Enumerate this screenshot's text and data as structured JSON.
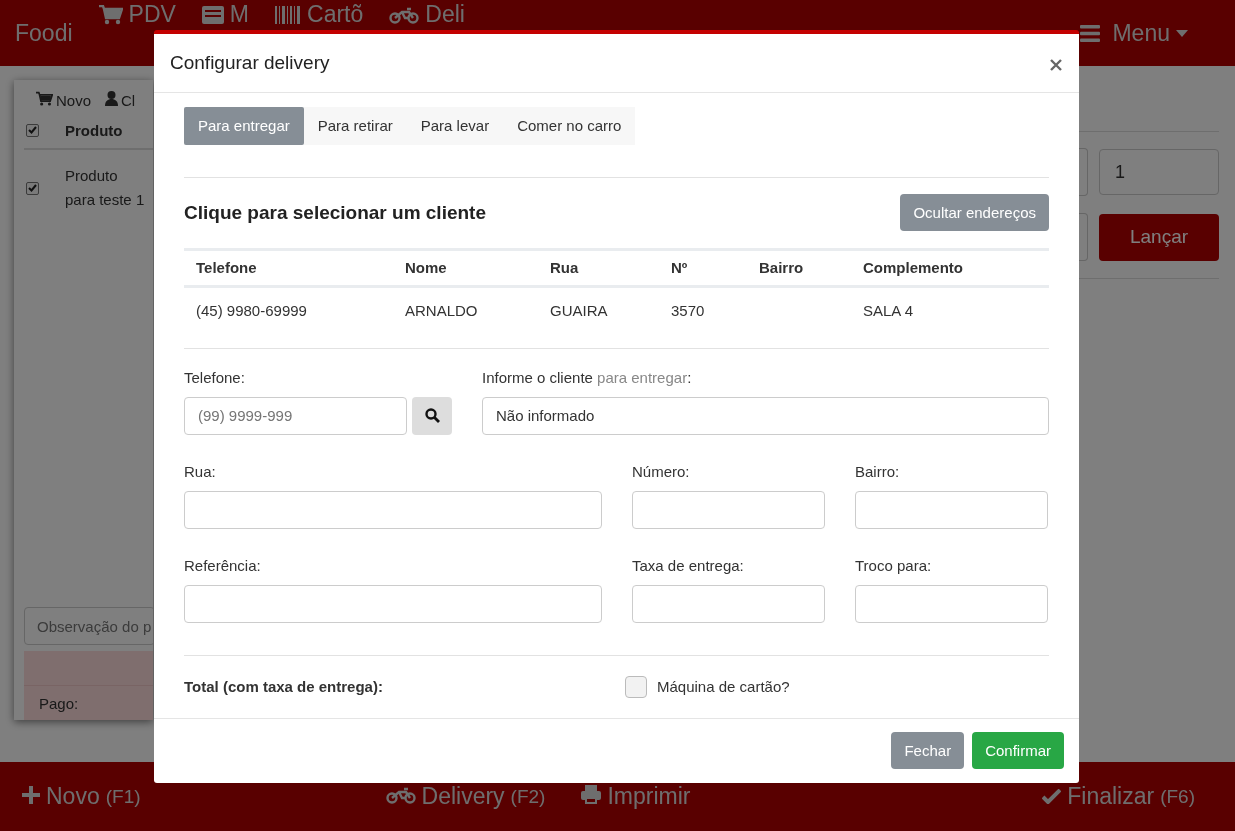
{
  "navbar": {
    "brand": "Foodi",
    "items": [
      {
        "label": "PDV"
      },
      {
        "label": "M"
      },
      {
        "label": "Cartõ"
      },
      {
        "label": "Deli"
      }
    ],
    "menu": "Menu"
  },
  "order_panel": {
    "toolbar": [
      "Novo",
      "Cl"
    ],
    "header": "Produto",
    "header_checked": true,
    "rows": [
      {
        "lines": [
          "Produto",
          "para teste 1"
        ],
        "checked": true
      }
    ],
    "note_placeholder": "Observação do p",
    "paid_label": "Pago:"
  },
  "launch_panel": {
    "quantity": "1",
    "launch_button": "Lançar"
  },
  "bottom_bar": [
    {
      "label": "Novo",
      "key": "(F1)"
    },
    {
      "label": "Delivery",
      "key": "(F2)"
    },
    {
      "label": "Imprimir"
    },
    {
      "label": "Finalizar",
      "key": "(F6)"
    }
  ],
  "modal": {
    "title": "Configurar delivery",
    "tabs": [
      {
        "label": "Para entregar",
        "selected": true
      },
      {
        "label": "Para retirar",
        "selected": false
      },
      {
        "label": "Para levar",
        "selected": false
      },
      {
        "label": "Comer no carro",
        "selected": false
      }
    ],
    "section_title": "Clique para selecionar um cliente",
    "toggle_button": "Ocultar endereços",
    "table": {
      "columns": [
        "Telefone",
        "Nome",
        "Rua",
        "Nº",
        "Bairro",
        "Complemento"
      ],
      "rows": [
        [
          "(45) 9980-69999",
          "ARNALDO",
          "GUAIRA",
          "3570",
          null,
          "SALA 4"
        ]
      ]
    },
    "phone": {
      "label": "Telefone:",
      "placeholder": "(99) 9999-999"
    },
    "client": {
      "label": "Informe o cliente",
      "label_hint": "para entregar",
      "label_end": ":",
      "value": "Não informado"
    },
    "fields": [
      {
        "label": "Rua:"
      },
      {
        "label": "Número:"
      },
      {
        "label": "Bairro:"
      },
      {
        "label": "Referência:"
      },
      {
        "label": "Taxa de entrega:"
      },
      {
        "label": "Troco para:"
      }
    ],
    "total_label": "Total (com taxa de entrega):",
    "card_machine": {
      "label": "Máquina de cartão?",
      "checked": false
    },
    "buttons": {
      "close": "Fechar",
      "confirm": "Confirmar"
    }
  }
}
